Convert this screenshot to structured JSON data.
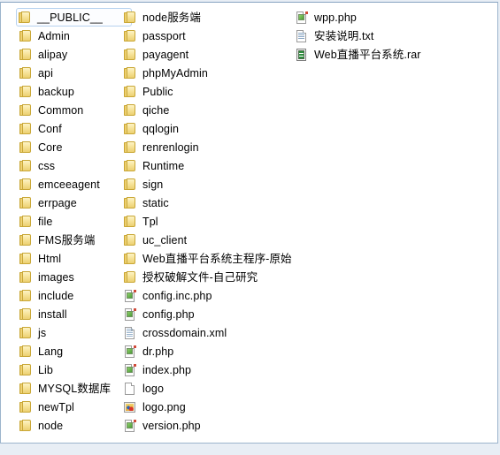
{
  "window": {
    "accent_border": "#9cb4cc",
    "background": "#ffffff",
    "selection_border": "#b6d2ef"
  },
  "columns": [
    {
      "name": "column-1",
      "items": [
        {
          "label": "__PUBLIC__",
          "icon": "folder-icon",
          "type": "folder",
          "selected": true
        },
        {
          "label": "Admin",
          "icon": "folder-icon",
          "type": "folder",
          "selected": false
        },
        {
          "label": "alipay",
          "icon": "folder-icon",
          "type": "folder",
          "selected": false
        },
        {
          "label": "api",
          "icon": "folder-icon",
          "type": "folder",
          "selected": false
        },
        {
          "label": "backup",
          "icon": "folder-icon",
          "type": "folder",
          "selected": false
        },
        {
          "label": "Common",
          "icon": "folder-icon",
          "type": "folder",
          "selected": false
        },
        {
          "label": "Conf",
          "icon": "folder-icon",
          "type": "folder",
          "selected": false
        },
        {
          "label": "Core",
          "icon": "folder-icon",
          "type": "folder",
          "selected": false
        },
        {
          "label": "css",
          "icon": "folder-icon",
          "type": "folder",
          "selected": false
        },
        {
          "label": "emceeagent",
          "icon": "folder-icon",
          "type": "folder",
          "selected": false
        },
        {
          "label": "errpage",
          "icon": "folder-icon",
          "type": "folder",
          "selected": false
        },
        {
          "label": "file",
          "icon": "folder-icon",
          "type": "folder",
          "selected": false
        },
        {
          "label": "FMS服务端",
          "icon": "folder-icon",
          "type": "folder",
          "selected": false
        },
        {
          "label": "Html",
          "icon": "folder-icon",
          "type": "folder",
          "selected": false
        },
        {
          "label": "images",
          "icon": "folder-icon",
          "type": "folder",
          "selected": false
        },
        {
          "label": "include",
          "icon": "folder-icon",
          "type": "folder",
          "selected": false
        },
        {
          "label": "install",
          "icon": "folder-icon",
          "type": "folder",
          "selected": false
        },
        {
          "label": "js",
          "icon": "folder-icon",
          "type": "folder",
          "selected": false
        },
        {
          "label": "Lang",
          "icon": "folder-icon",
          "type": "folder",
          "selected": false
        },
        {
          "label": "Lib",
          "icon": "folder-icon",
          "type": "folder",
          "selected": false
        },
        {
          "label": "MYSQL数据库",
          "icon": "folder-icon",
          "type": "folder",
          "selected": false
        },
        {
          "label": "newTpl",
          "icon": "folder-icon",
          "type": "folder",
          "selected": false
        },
        {
          "label": "node",
          "icon": "folder-icon",
          "type": "folder",
          "selected": false
        }
      ]
    },
    {
      "name": "column-2",
      "items": [
        {
          "label": "node服务端",
          "icon": "folder-icon",
          "type": "folder",
          "selected": false
        },
        {
          "label": "passport",
          "icon": "folder-icon",
          "type": "folder",
          "selected": false
        },
        {
          "label": "payagent",
          "icon": "folder-icon",
          "type": "folder",
          "selected": false
        },
        {
          "label": "phpMyAdmin",
          "icon": "folder-icon",
          "type": "folder",
          "selected": false
        },
        {
          "label": "Public",
          "icon": "folder-icon",
          "type": "folder",
          "selected": false
        },
        {
          "label": "qiche",
          "icon": "folder-icon",
          "type": "folder",
          "selected": false
        },
        {
          "label": "qqlogin",
          "icon": "folder-icon",
          "type": "folder",
          "selected": false
        },
        {
          "label": "renrenlogin",
          "icon": "folder-icon",
          "type": "folder",
          "selected": false
        },
        {
          "label": "Runtime",
          "icon": "folder-icon",
          "type": "folder",
          "selected": false
        },
        {
          "label": "sign",
          "icon": "folder-icon",
          "type": "folder",
          "selected": false
        },
        {
          "label": "static",
          "icon": "folder-icon",
          "type": "folder",
          "selected": false
        },
        {
          "label": "Tpl",
          "icon": "folder-icon",
          "type": "folder",
          "selected": false
        },
        {
          "label": "uc_client",
          "icon": "folder-icon",
          "type": "folder",
          "selected": false
        },
        {
          "label": "Web直播平台系统主程序-原始",
          "icon": "folder-icon",
          "type": "folder",
          "selected": false
        },
        {
          "label": "授权破解文件-自己研究",
          "icon": "folder-icon",
          "type": "folder",
          "selected": false
        },
        {
          "label": "config.inc.php",
          "icon": "php-file-icon",
          "type": "php",
          "selected": false
        },
        {
          "label": "config.php",
          "icon": "php-file-icon",
          "type": "php",
          "selected": false
        },
        {
          "label": "crossdomain.xml",
          "icon": "xml-file-icon",
          "type": "xml",
          "selected": false
        },
        {
          "label": "dr.php",
          "icon": "php-file-icon",
          "type": "php",
          "selected": false
        },
        {
          "label": "index.php",
          "icon": "php-file-icon",
          "type": "php",
          "selected": false
        },
        {
          "label": "logo",
          "icon": "blank-file-icon",
          "type": "blank",
          "selected": false
        },
        {
          "label": "logo.png",
          "icon": "png-file-icon",
          "type": "png",
          "selected": false
        },
        {
          "label": "version.php",
          "icon": "php-file-icon",
          "type": "php",
          "selected": false
        }
      ]
    },
    {
      "name": "column-3",
      "items": [
        {
          "label": "wpp.php",
          "icon": "php-file-icon",
          "type": "php",
          "selected": false
        },
        {
          "label": "安装说明.txt",
          "icon": "txt-file-icon",
          "type": "txt",
          "selected": false
        },
        {
          "label": "Web直播平台系统.rar",
          "icon": "rar-file-icon",
          "type": "rar",
          "selected": false
        }
      ]
    }
  ]
}
